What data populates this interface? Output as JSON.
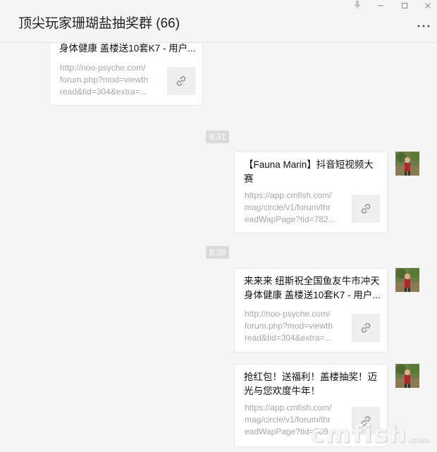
{
  "window": {
    "title": "顶尖玩家珊瑚盐抽奖群 (66)",
    "pin_icon": "pin-icon",
    "minimize_icon": "minimize-icon",
    "maximize_icon": "maximize-icon",
    "close_icon": "close-icon",
    "more_icon": "more-options-icon"
  },
  "messages": [
    {
      "title_lines": [
        "身体健康 盖楼送10套K7 - 用户..."
      ],
      "url_lines": [
        "http://noo-psyche.com/",
        "forum.php?mod=viewth",
        "read&tid=304&extra=..."
      ]
    },
    {
      "time": "8:31",
      "title_lines": [
        "【Fauna Marin】抖音短视频大",
        "赛"
      ],
      "url_lines": [
        "https://app.cmfish.com/",
        "mag/circle/v1/forum/thr",
        "eadWapPage?tid=782..."
      ]
    },
    {
      "time": "8:38",
      "title_lines": [
        "来来来 纽斯祝全国鱼友牛市冲天",
        "身体健康 盖楼送10套K7 - 用户..."
      ],
      "url_lines": [
        "http://noo-psyche.com/",
        "forum.php?mod=viewth",
        "read&tid=304&extra=..."
      ]
    },
    {
      "title_lines": [
        "抢红包！送福利！盖楼抽奖！迈",
        "光与您欢度牛年！"
      ],
      "url_lines": [
        "https://app.cmfish.com/",
        "mag/circle/v1/forum/thr",
        "eadWapPage?tid=789..."
      ]
    }
  ],
  "link_icon": "link-icon",
  "watermark": {
    "text": "cmfish",
    "suffix": ".com"
  }
}
